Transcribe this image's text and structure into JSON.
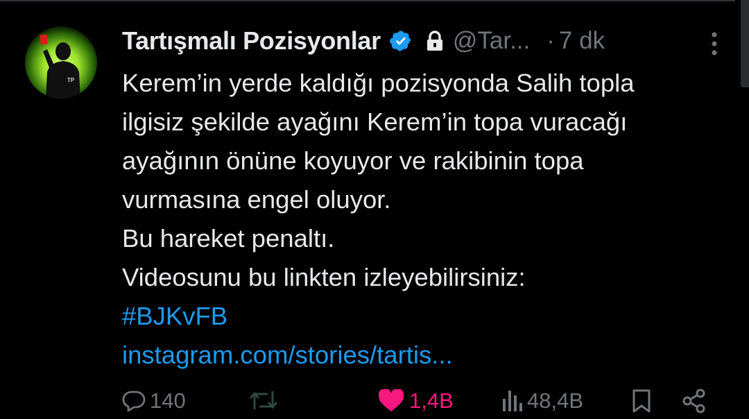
{
  "author": {
    "display_name": "Tartışmalı Pozisyonlar",
    "handle": "@Tar...",
    "verified": true,
    "protected": true,
    "avatar_icon": "referee-red-card-avatar",
    "avatar_text": "TP"
  },
  "meta": {
    "separator": "·",
    "time": "7 dk"
  },
  "tweet": {
    "lines": [
      "Kerem’in yerde kaldığı pozisyonda Salih topla",
      "ilgisiz şekilde ayağını Kerem’in topa vuracağı",
      "ayağının önüne koyuyor ve rakibinin topa",
      "vurmasına engel oluyor.",
      "Bu hareket penaltı.",
      "Videosunu bu linkten izleyebilirsiniz:"
    ],
    "hashtag": "#BJKvFB",
    "link": "instagram.com/stories/tartis..."
  },
  "actions": {
    "reply_count": "140",
    "retweet_count": "",
    "like_count": "1,4B",
    "views_count": "48,4B"
  },
  "colors": {
    "background": "#000000",
    "text": "#e7e9ea",
    "muted": "#71767b",
    "link": "#1d9bf0",
    "like": "#f91880",
    "retweet_icon": "#2a4a3a",
    "avatar_glow": "#9be22a"
  }
}
